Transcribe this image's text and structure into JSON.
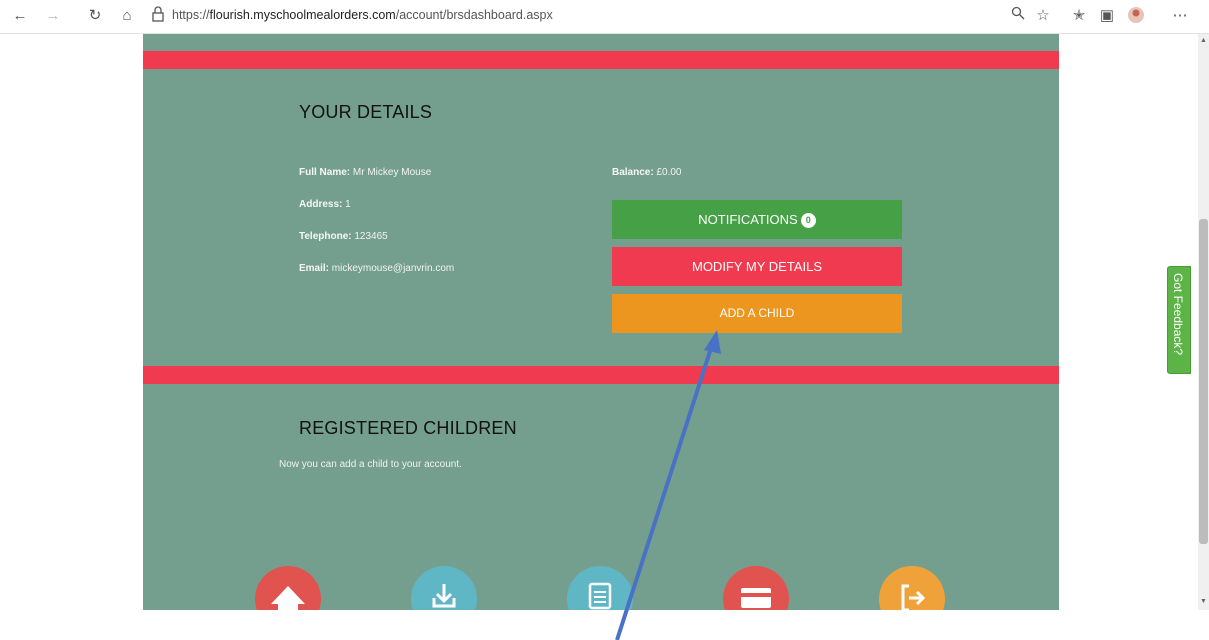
{
  "browser": {
    "url_prefix": "https://",
    "url_host": "flourish.myschoolmealorders.com",
    "url_path": "/account/brsdashboard.aspx"
  },
  "details": {
    "title": "YOUR DETAILS",
    "full_name_label": "Full Name:",
    "full_name": "Mr Mickey Mouse",
    "address_label": "Address:",
    "address": "1",
    "telephone_label": "Telephone:",
    "telephone": "123465",
    "email_label": "Email:",
    "email": "mickeymouse@janvrin.com",
    "balance_label": "Balance:",
    "balance": "£0.00"
  },
  "buttons": {
    "notifications_label": "NOTIFICATIONS",
    "notifications_count": "0",
    "modify_label": "MODIFY MY DETAILS",
    "add_child_label": "ADD A CHILD"
  },
  "children": {
    "title": "REGISTERED CHILDREN",
    "message": "Now you can add a child to your account."
  },
  "feedback": {
    "label": "Got Feedback?"
  },
  "colors": {
    "panel": "#749f8e",
    "band": "#ef3a4f",
    "notifications": "#46a046",
    "modify": "#ef3a4f",
    "add_child": "#ec9620",
    "annotation_arrow": "#4a72c4"
  },
  "icons": [
    "back-icon",
    "forward-icon",
    "refresh-icon",
    "home-icon",
    "lock-icon",
    "search-icon",
    "star-icon",
    "favorites-icon",
    "collections-icon",
    "profile-icon",
    "more-icon",
    "house-icon",
    "download-icon",
    "clipboard-icon",
    "card-icon",
    "logout-icon"
  ]
}
